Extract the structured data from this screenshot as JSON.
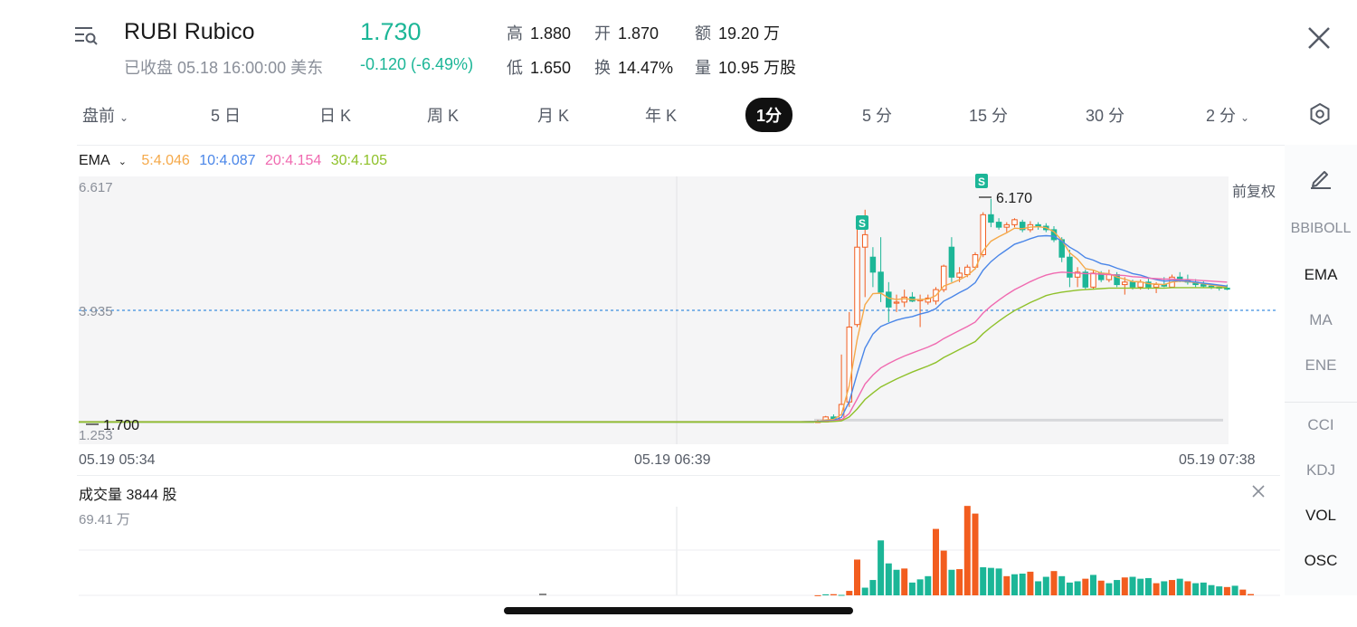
{
  "header": {
    "symbol": "RUBI",
    "name": "Rubico",
    "status": "已收盘 05.18 16:00:00 美东",
    "price": "1.730",
    "change": "-0.120 (-6.49%)",
    "stats": {
      "high_label": "高",
      "high": "1.880",
      "open_label": "开",
      "open": "1.870",
      "amount_label": "额",
      "amount": "19.20 万",
      "low_label": "低",
      "low": "1.650",
      "turnover_label": "换",
      "turnover": "14.47%",
      "volume_label": "量",
      "volume": "10.95 万股"
    }
  },
  "tabs": [
    {
      "label": "盘前",
      "dropdown": true
    },
    {
      "label": "5 日"
    },
    {
      "label": "日 K"
    },
    {
      "label": "周 K"
    },
    {
      "label": "月 K"
    },
    {
      "label": "年 K"
    },
    {
      "label": "1分",
      "active": true
    },
    {
      "label": "5 分"
    },
    {
      "label": "15 分"
    },
    {
      "label": "30 分"
    },
    {
      "label": "2 分",
      "dropdown": true
    }
  ],
  "ema": {
    "label": "EMA",
    "values": [
      {
        "text": "5:4.046",
        "color": "#f5a94a"
      },
      {
        "text": "10:4.087",
        "color": "#4a86e8"
      },
      {
        "text": "20:4.154",
        "color": "#f06ab0"
      },
      {
        "text": "30:4.105",
        "color": "#8fc12a"
      }
    ]
  },
  "axis": {
    "ymax": "6.617",
    "ymid": "3.935",
    "ymin": "1.253",
    "low_marker": "1.700",
    "high_marker": "6.170",
    "adjust_label": "前复权",
    "signal_label": "S",
    "times": [
      "05.19 05:34",
      "05.19 06:39",
      "05.19 07:38"
    ]
  },
  "sidebar": {
    "items": [
      "BBIBOLL",
      "EMA",
      "MA",
      "ENE",
      "CCI",
      "KDJ",
      "VOL",
      "OSC"
    ],
    "active": [
      "EMA",
      "VOL",
      "OSC"
    ]
  },
  "volume": {
    "title": "成交量 3844 股",
    "max_label": "69.41 万"
  },
  "colors": {
    "up": "#1cb697",
    "down": "#f25d1f",
    "accent": "#1cb697"
  },
  "chart_data": {
    "type": "candlestick",
    "ylim": [
      1.253,
      6.617
    ],
    "reference_price": 3.935,
    "candles": [
      {
        "o": 1.7,
        "h": 1.74,
        "l": 1.69,
        "c": 1.71
      },
      {
        "o": 1.7,
        "h": 1.82,
        "l": 1.69,
        "c": 1.8
      },
      {
        "o": 1.8,
        "h": 1.85,
        "l": 1.72,
        "c": 1.76
      },
      {
        "o": 1.75,
        "h": 3.05,
        "l": 1.72,
        "c": 2.05
      },
      {
        "o": 2.1,
        "h": 3.9,
        "l": 2.0,
        "c": 3.6
      },
      {
        "o": 3.65,
        "h": 5.6,
        "l": 3.6,
        "c": 5.2
      },
      {
        "o": 5.2,
        "h": 5.95,
        "l": 4.2,
        "c": 5.45
      },
      {
        "o": 5.0,
        "h": 5.2,
        "l": 4.4,
        "c": 4.7
      },
      {
        "o": 4.7,
        "h": 5.4,
        "l": 4.1,
        "c": 4.3
      },
      {
        "o": 4.3,
        "h": 4.5,
        "l": 3.7,
        "c": 4.0
      },
      {
        "o": 4.1,
        "h": 4.25,
        "l": 3.9,
        "c": 4.1
      },
      {
        "o": 4.1,
        "h": 4.35,
        "l": 4.0,
        "c": 4.2
      },
      {
        "o": 4.2,
        "h": 4.3,
        "l": 4.1,
        "c": 4.12
      },
      {
        "o": 4.15,
        "h": 4.25,
        "l": 3.6,
        "c": 4.15
      },
      {
        "o": 4.1,
        "h": 4.25,
        "l": 4.05,
        "c": 4.18
      },
      {
        "o": 4.12,
        "h": 4.4,
        "l": 4.05,
        "c": 4.35
      },
      {
        "o": 4.35,
        "h": 4.85,
        "l": 4.3,
        "c": 4.82
      },
      {
        "o": 5.2,
        "h": 5.4,
        "l": 4.5,
        "c": 4.6
      },
      {
        "o": 4.6,
        "h": 4.8,
        "l": 4.5,
        "c": 4.68
      },
      {
        "o": 4.65,
        "h": 4.85,
        "l": 4.6,
        "c": 4.8
      },
      {
        "o": 4.8,
        "h": 5.1,
        "l": 4.75,
        "c": 5.05
      },
      {
        "o": 5.05,
        "h": 5.9,
        "l": 5.0,
        "c": 5.85
      },
      {
        "o": 5.85,
        "h": 6.17,
        "l": 5.6,
        "c": 5.7
      },
      {
        "o": 5.7,
        "h": 5.78,
        "l": 5.55,
        "c": 5.6
      },
      {
        "o": 5.6,
        "h": 5.7,
        "l": 5.5,
        "c": 5.65
      },
      {
        "o": 5.65,
        "h": 5.78,
        "l": 5.6,
        "c": 5.75
      },
      {
        "o": 5.7,
        "h": 5.75,
        "l": 5.5,
        "c": 5.55
      },
      {
        "o": 5.55,
        "h": 5.72,
        "l": 5.5,
        "c": 5.65
      },
      {
        "o": 5.65,
        "h": 5.7,
        "l": 5.55,
        "c": 5.62
      },
      {
        "o": 5.62,
        "h": 5.68,
        "l": 5.5,
        "c": 5.55
      },
      {
        "o": 5.55,
        "h": 5.62,
        "l": 5.3,
        "c": 5.35
      },
      {
        "o": 5.35,
        "h": 5.4,
        "l": 4.9,
        "c": 5.0
      },
      {
        "o": 5.0,
        "h": 5.15,
        "l": 4.4,
        "c": 4.6
      },
      {
        "o": 4.6,
        "h": 4.8,
        "l": 4.4,
        "c": 4.7
      },
      {
        "o": 4.7,
        "h": 4.75,
        "l": 4.35,
        "c": 4.4
      },
      {
        "o": 4.4,
        "h": 4.75,
        "l": 4.35,
        "c": 4.68
      },
      {
        "o": 4.68,
        "h": 4.72,
        "l": 4.5,
        "c": 4.55
      },
      {
        "o": 4.55,
        "h": 4.75,
        "l": 4.5,
        "c": 4.65
      },
      {
        "o": 4.65,
        "h": 4.7,
        "l": 4.4,
        "c": 4.45
      },
      {
        "o": 4.45,
        "h": 4.6,
        "l": 4.25,
        "c": 4.5
      },
      {
        "o": 4.5,
        "h": 4.55,
        "l": 4.35,
        "c": 4.4
      },
      {
        "o": 4.4,
        "h": 4.55,
        "l": 4.35,
        "c": 4.5
      },
      {
        "o": 4.5,
        "h": 4.58,
        "l": 4.35,
        "c": 4.4
      },
      {
        "o": 4.4,
        "h": 4.5,
        "l": 4.28,
        "c": 4.45
      },
      {
        "o": 4.45,
        "h": 4.6,
        "l": 4.4,
        "c": 4.42
      },
      {
        "o": 4.4,
        "h": 4.65,
        "l": 4.38,
        "c": 4.6
      },
      {
        "o": 4.6,
        "h": 4.7,
        "l": 4.5,
        "c": 4.55
      },
      {
        "o": 4.55,
        "h": 4.65,
        "l": 4.45,
        "c": 4.5
      },
      {
        "o": 4.5,
        "h": 4.56,
        "l": 4.4,
        "c": 4.45
      },
      {
        "o": 4.45,
        "h": 4.52,
        "l": 4.38,
        "c": 4.42
      },
      {
        "o": 4.42,
        "h": 4.46,
        "l": 4.36,
        "c": 4.4
      },
      {
        "o": 4.4,
        "h": 4.44,
        "l": 4.33,
        "c": 4.38
      },
      {
        "o": 4.38,
        "h": 4.45,
        "l": 4.34,
        "c": 4.36
      }
    ],
    "flat_price": 1.7,
    "ema_series": [
      {
        "name": "5",
        "color": "#f5a94a",
        "values": [
          1.71,
          1.74,
          1.75,
          1.85,
          2.43,
          3.35,
          4.05,
          4.27,
          4.28,
          4.18,
          4.15,
          4.17,
          4.15,
          4.15,
          4.16,
          4.23,
          4.42,
          4.48,
          4.55,
          4.63,
          4.77,
          5.13,
          5.32,
          5.41,
          5.49,
          5.58,
          5.57,
          5.6,
          5.61,
          5.59,
          5.51,
          5.34,
          5.09,
          4.96,
          4.77,
          4.74,
          4.68,
          4.67,
          4.6,
          4.56,
          4.51,
          4.51,
          4.47,
          4.46,
          4.45,
          4.5,
          4.52,
          4.51,
          4.49,
          4.47,
          4.44,
          4.42,
          4.4
        ]
      },
      {
        "name": "10",
        "color": "#4a86e8",
        "values": [
          1.71,
          1.72,
          1.73,
          1.79,
          2.11,
          2.67,
          3.18,
          3.46,
          3.61,
          3.68,
          3.74,
          3.78,
          3.81,
          3.86,
          3.9,
          3.97,
          4.12,
          4.2,
          4.29,
          4.37,
          4.49,
          4.74,
          4.91,
          5.04,
          5.15,
          5.26,
          5.31,
          5.37,
          5.42,
          5.43,
          5.42,
          5.32,
          5.2,
          5.11,
          4.99,
          4.94,
          4.87,
          4.84,
          4.78,
          4.73,
          4.67,
          4.64,
          4.59,
          4.55,
          4.52,
          4.53,
          4.53,
          4.52,
          4.5,
          4.48,
          4.46,
          4.44,
          4.42
        ]
      },
      {
        "name": "20",
        "color": "#f06ab0",
        "values": [
          1.7,
          1.71,
          1.72,
          1.74,
          1.87,
          2.16,
          2.46,
          2.64,
          2.78,
          2.87,
          2.95,
          3.02,
          3.08,
          3.14,
          3.2,
          3.27,
          3.37,
          3.45,
          3.53,
          3.61,
          3.7,
          3.88,
          4.02,
          4.14,
          4.25,
          4.35,
          4.43,
          4.51,
          4.58,
          4.64,
          4.68,
          4.7,
          4.69,
          4.68,
          4.67,
          4.67,
          4.66,
          4.65,
          4.64,
          4.63,
          4.61,
          4.6,
          4.58,
          4.57,
          4.56,
          4.56,
          4.55,
          4.55,
          4.54,
          4.53,
          4.52,
          4.51,
          4.5
        ]
      },
      {
        "name": "30",
        "color": "#8fc12a",
        "values": [
          1.7,
          1.7,
          1.71,
          1.72,
          1.8,
          1.96,
          2.15,
          2.28,
          2.4,
          2.48,
          2.56,
          2.63,
          2.7,
          2.76,
          2.82,
          2.89,
          2.99,
          3.07,
          3.15,
          3.23,
          3.31,
          3.47,
          3.6,
          3.72,
          3.83,
          3.93,
          4.01,
          4.09,
          4.16,
          4.23,
          4.27,
          4.3,
          4.32,
          4.34,
          4.35,
          4.36,
          4.37,
          4.38,
          4.38,
          4.38,
          4.38,
          4.38,
          4.38,
          4.38,
          4.38,
          4.39,
          4.39,
          4.39,
          4.39,
          4.39,
          4.39,
          4.39,
          4.39
        ]
      }
    ],
    "volume_ylim": [
      0,
      694100
    ],
    "volumes": [
      800,
      8000,
      9000,
      3500,
      35000,
      280000,
      60000,
      120000,
      430000,
      250000,
      200000,
      210000,
      100000,
      125000,
      150000,
      520000,
      350000,
      200000,
      205000,
      700000,
      640000,
      220000,
      215000,
      210000,
      150000,
      165000,
      170000,
      185000,
      110000,
      145000,
      190000,
      150000,
      100000,
      110000,
      130000,
      160000,
      115000,
      95000,
      120000,
      140000,
      145000,
      130000,
      135000,
      95000,
      110000,
      120000,
      130000,
      110000,
      95000,
      100000,
      80000,
      70000,
      65000,
      75000,
      45000,
      10000
    ],
    "volume_up": [
      false,
      true,
      false,
      true,
      false,
      false,
      true,
      true,
      true,
      true,
      true,
      false,
      true,
      true,
      true,
      false,
      false,
      true,
      false,
      false,
      false,
      true,
      true,
      true,
      false,
      true,
      true,
      false,
      true,
      true,
      false,
      true,
      true,
      true,
      false,
      true,
      false,
      true,
      true,
      false,
      true,
      true,
      true,
      false,
      true,
      false,
      true,
      false,
      true,
      true,
      true,
      true,
      false,
      true,
      false,
      false
    ]
  }
}
